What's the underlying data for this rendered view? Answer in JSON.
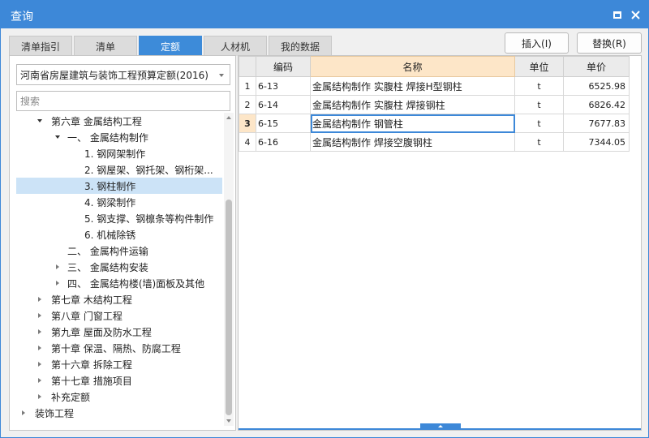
{
  "window": {
    "title": "查询"
  },
  "tabs": [
    {
      "label": "清单指引"
    },
    {
      "label": "清单"
    },
    {
      "label": "定额",
      "active": true
    },
    {
      "label": "人材机"
    },
    {
      "label": "我的数据"
    }
  ],
  "actions": {
    "insert_label": "插入(I)",
    "replace_label": "替换(R)"
  },
  "left": {
    "quota_library": "河南省房屋建筑与装饰工程预算定额(2016)",
    "search_placeholder": "搜索",
    "tree": [
      {
        "label": "第六章 金属结构工程",
        "expanded": true
      },
      {
        "label": "一、 金属结构制作",
        "expanded": true
      },
      {
        "label": "1. 钢网架制作"
      },
      {
        "label": "2. 钢屋架、钢托架、钢桁架..."
      },
      {
        "label": "3. 钢柱制作",
        "selected": true
      },
      {
        "label": "4. 钢梁制作"
      },
      {
        "label": "5. 钢支撑、钢檩条等构件制作"
      },
      {
        "label": "6. 机械除锈"
      },
      {
        "label": "二、 金属构件运输"
      },
      {
        "label": "三、 金属结构安装",
        "expanded": false
      },
      {
        "label": "四、 金属结构楼(墙)面板及其他",
        "expanded": false
      },
      {
        "label": "第七章 木结构工程",
        "expanded": false
      },
      {
        "label": "第八章 门窗工程",
        "expanded": false
      },
      {
        "label": "第九章 屋面及防水工程",
        "expanded": false
      },
      {
        "label": "第十章 保温、隔热、防腐工程",
        "expanded": false
      },
      {
        "label": "第十六章 拆除工程",
        "expanded": false
      },
      {
        "label": "第十七章 措施项目",
        "expanded": false
      },
      {
        "label": "补充定额",
        "expanded": false
      },
      {
        "label": "装饰工程",
        "expanded": false
      }
    ]
  },
  "grid": {
    "headers": {
      "code": "编码",
      "name": "名称",
      "unit": "单位",
      "price": "单价"
    },
    "rows": [
      {
        "num": "1",
        "code": "6-13",
        "name": "金属结构制作 实腹柱 焊接H型钢柱",
        "unit": "t",
        "price": "6525.98"
      },
      {
        "num": "2",
        "code": "6-14",
        "name": "金属结构制作 实腹柱 焊接钢柱",
        "unit": "t",
        "price": "6826.42"
      },
      {
        "num": "3",
        "code": "6-15",
        "name": "金属结构制作 钢管柱",
        "unit": "t",
        "price": "7677.83",
        "current": true
      },
      {
        "num": "4",
        "code": "6-16",
        "name": "金属结构制作 焊接空腹钢柱",
        "unit": "t",
        "price": "7344.05"
      }
    ]
  },
  "colors": {
    "accent": "#3d88d8",
    "selected_row": "#cce3f7",
    "name_header": "#fde6c8"
  }
}
